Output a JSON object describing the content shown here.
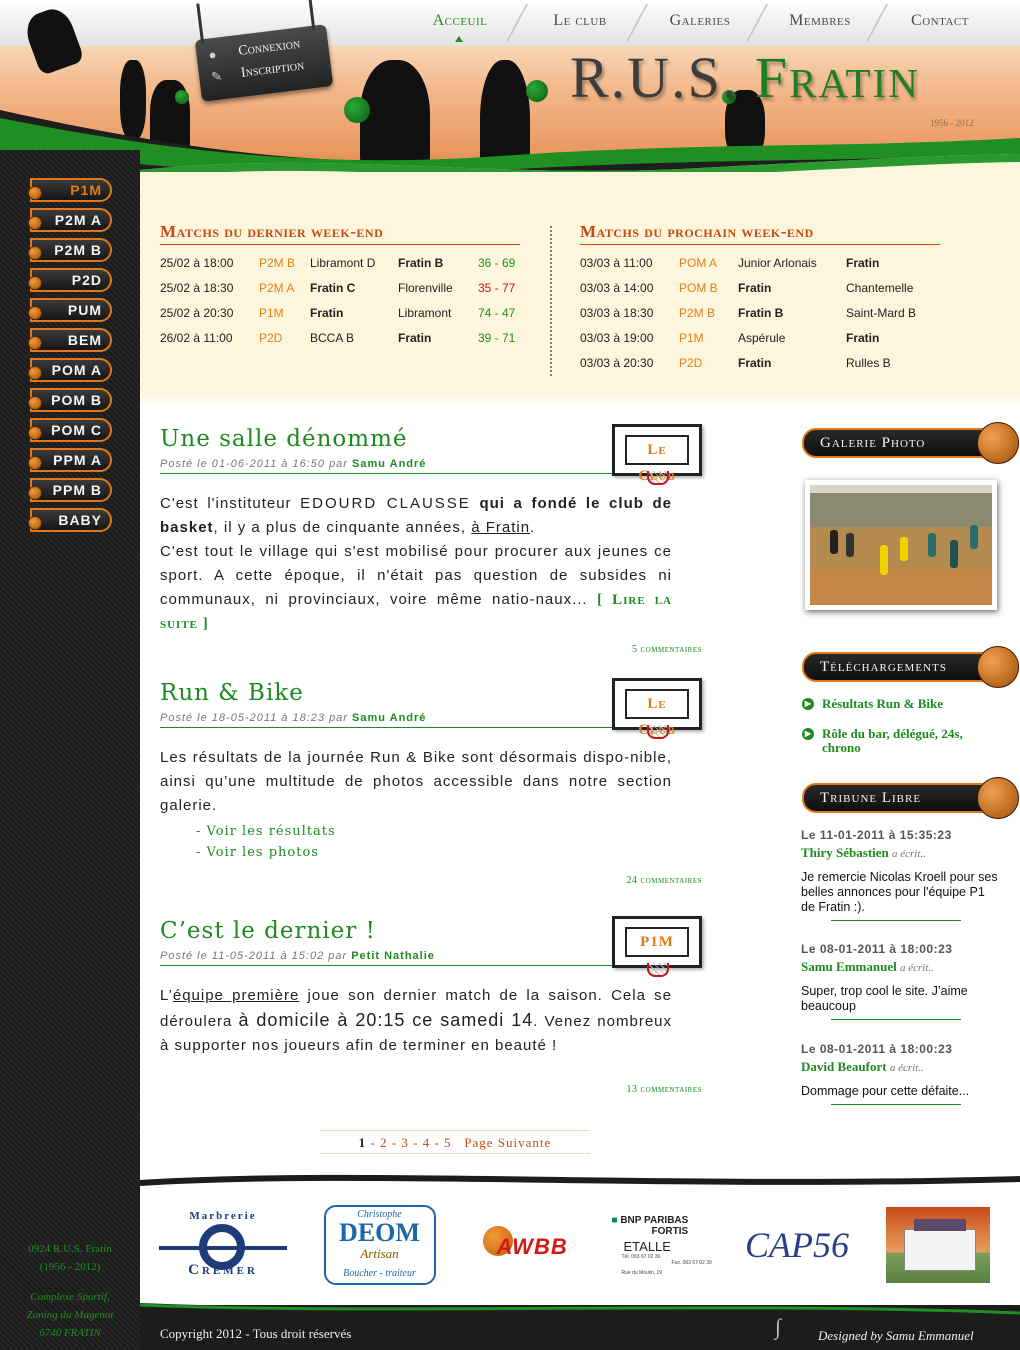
{
  "nav": {
    "items": [
      {
        "label": "Acceuil",
        "active": true
      },
      {
        "label": "Le club"
      },
      {
        "label": "Galeries"
      },
      {
        "label": "Membres"
      },
      {
        "label": "Contact"
      }
    ]
  },
  "account": {
    "login": "Connexion",
    "register": "Inscription"
  },
  "logo": {
    "first": "R.U.S.",
    "second": "Fratin",
    "years": "1956 - 2012"
  },
  "levels": [
    "P1M",
    "P2M A",
    "P2M B",
    "P2D",
    "PUM",
    "BEM",
    "POM A",
    "POM B",
    "POM C",
    "PPM A",
    "PPM B",
    "BABY"
  ],
  "last_weekend": {
    "title": "Matchs du dernier week-end",
    "rows": [
      {
        "date": "25/02 à 18:00",
        "cat": "P2M B",
        "home": "Libramont D",
        "away": "Fratin B",
        "score": "36 - 69",
        "win": true
      },
      {
        "date": "25/02 à 18:30",
        "cat": "P2M A",
        "home": "Fratin C",
        "away": "Florenville",
        "score": "35 - 77",
        "win": false
      },
      {
        "date": "25/02 à 20:30",
        "cat": "P1M",
        "home": "Fratin",
        "away": "Libramont",
        "score": "74 - 47",
        "win": true
      },
      {
        "date": "26/02 à 11:00",
        "cat": "P2D",
        "home": "BCCA B",
        "away": "Fratin",
        "score": "39 - 71",
        "win": true
      }
    ]
  },
  "next_weekend": {
    "title": "Matchs du prochain week-end",
    "rows": [
      {
        "date": "03/03 à 11:00",
        "cat": "POM A",
        "home": "Junior Arlonais",
        "away": "Fratin"
      },
      {
        "date": "03/03 à 14:00",
        "cat": "POM B",
        "home": "Fratin",
        "away": "Chantemelle"
      },
      {
        "date": "03/03 à 18:30",
        "cat": "P2M B",
        "home": "Fratin B",
        "away": "Saint-Mard B"
      },
      {
        "date": "03/03 à 19:00",
        "cat": "P1M",
        "home": "Aspérule",
        "away": "Fratin"
      },
      {
        "date": "03/03 à 20:30",
        "cat": "P2D",
        "home": "Fratin",
        "away": "Rulles B"
      }
    ]
  },
  "articles": [
    {
      "title": "Une salle dénommé",
      "meta": "Posté le 01-06-2011 à 16:50 par",
      "author": "Samu André",
      "badge": "Le Club",
      "p1a": "C'est l'instituteur ",
      "p1b": "EDOURD CLAUSSE",
      "p1c": " qui a fondé le club de basket",
      "p1d": ", il y a plus de cinquante années, ",
      "p1e": "à Fratin",
      "p1f": ".",
      "p2": "C'est tout le village qui s'est mobilisé pour procurer aux jeunes ce sport. A cette époque, il n'était pas question de subsides ni communaux, ni provinciaux, voire même natio-naux...",
      "read_more": "[ Lire la suite ]",
      "comments": "5 commentaires"
    },
    {
      "title": "Run & Bike",
      "meta": "Posté le 18-05-2011 à 18:23 par",
      "author": "Samu André",
      "badge": "Le Club",
      "body": "Les résultats de la journée Run & Bike sont désormais dispo-nible, ainsi qu’une multitude de photos accessible dans notre section galerie.",
      "link1": "- Voir les résultats",
      "link2": "- Voir les photos",
      "comments": "24 commentaires"
    },
    {
      "title": "C’est le dernier !",
      "meta": "Posté le 11-05-2011 à 15:02 par",
      "author": "Petit Nathalie",
      "badge": "P1M",
      "a": "L’",
      "b": "équipe première",
      "c": " joue son dernier match",
      "d": " de la saison. Cela se déroulera ",
      "e": "à domicile à 20:15 ce samedi 14",
      "f": ". ",
      "g": "Venez nombreux",
      "h": " à supporter nos joueurs afin de terminer en beauté !",
      "comments": "13 commentaires"
    }
  ],
  "pagination": {
    "current": "1",
    "pages": [
      "2",
      "3",
      "4",
      "5"
    ],
    "next": "Page Suivante"
  },
  "gallery": {
    "title": "Galerie Photo"
  },
  "downloads": {
    "title": "Téléchargements",
    "items": [
      "Résultats Run & Bike",
      "Rôle du bar, délégué, 24s, chrono"
    ]
  },
  "tribune": {
    "title": "Tribune Libre",
    "wrote": "a écrit..",
    "posts": [
      {
        "date": "Le 11-01-2011 à 15:35:23",
        "author": "Thiry Sébastien",
        "message": "Je remercie Nicolas Kroell pour ses belles annonces pour l'équipe P1 de Fratin :)."
      },
      {
        "date": "Le 08-01-2011 à 18:00:23",
        "author": "Samu Emmanuel",
        "message": "Super, trop cool le site. J’aime beaucoup"
      },
      {
        "date": "Le 08-01-2011 à 18:00:23",
        "author": "David Beaufort",
        "message": "Dommage pour cette défaite..."
      }
    ]
  },
  "sponsors": {
    "cremer_top": "Marbrerie",
    "cremer_bottom": "Cremer",
    "deom_top": "Christophe",
    "deom_name": "DEOM",
    "deom_sub": "Artisan",
    "deom_bottom": "Boucher - traiteur",
    "awbb": "AWBB",
    "bnp_1": "BNP PARIBAS",
    "bnp_2": "FORTIS",
    "bnp_3": "ETALLE",
    "bnp_tel": "Tél. 063 67 02 30",
    "bnp_fax": "Fax. 063 67 02 39",
    "bnp_addr": "Rue du Moulin, 19",
    "cap": "CAP56"
  },
  "club_info": {
    "line1": "0924 R.U.S. Fratin",
    "line2": "(1956 - 2012)",
    "addr1": "Complexe Sportif,",
    "addr2": "Zoning du Magenot",
    "addr3": "6740 FRATIN"
  },
  "footer": {
    "copyright": "Copyright 2012 - Tous droit réservés",
    "designed": "Designed by Samu Emmanuel"
  },
  "colors": {
    "green": "#1e8a20",
    "orange": "#e07a16",
    "red": "#c44a10",
    "cream": "#fdf6dc"
  }
}
